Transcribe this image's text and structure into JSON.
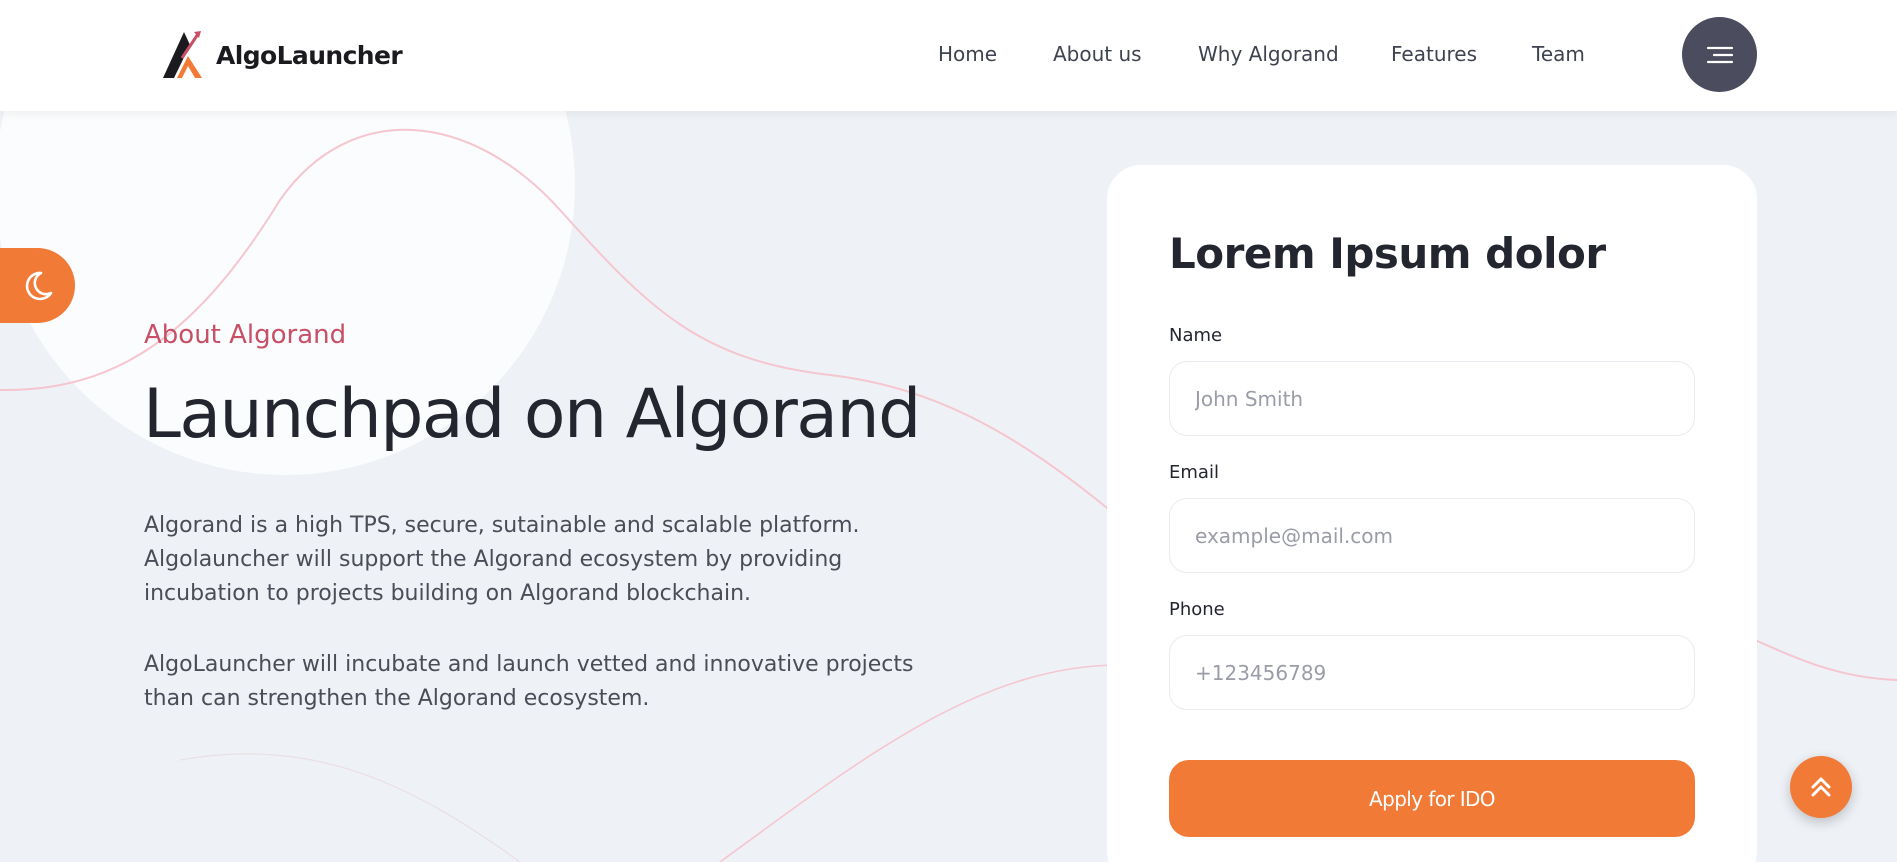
{
  "brand": {
    "name": "AlgoLauncher",
    "accent_color": "#f07a36",
    "eyebrow_color": "#c74f66",
    "menu_button_color": "#4b4d5e"
  },
  "nav": {
    "items": [
      {
        "label": "Home"
      },
      {
        "label": "About us"
      },
      {
        "label": "Why Algorand"
      },
      {
        "label": "Features"
      },
      {
        "label": "Team"
      }
    ],
    "menu_icon": "hamburger-icon"
  },
  "theme_toggle": {
    "icon": "moon-icon"
  },
  "hero": {
    "eyebrow": "About Algorand",
    "title": "Launchpad on Algorand",
    "paragraph_1": "Algorand is a high TPS, secure, sutainable and scalable platform. Algolauncher will support the Algorand ecosystem by providing incubation to projects building on Algorand blockchain.",
    "paragraph_2": "AlgoLauncher will incubate and launch vetted and innovative projects than can strengthen the Algorand ecosystem."
  },
  "form": {
    "title": "Lorem Ipsum dolor",
    "fields": [
      {
        "label": "Name",
        "placeholder": "John Smith",
        "value": ""
      },
      {
        "label": "Email",
        "placeholder": "example@mail.com",
        "value": ""
      },
      {
        "label": "Phone",
        "placeholder": "+123456789",
        "value": ""
      }
    ],
    "submit_label": "Apply for IDO"
  },
  "scroll_top": {
    "icon": "double-chevron-up-icon"
  }
}
